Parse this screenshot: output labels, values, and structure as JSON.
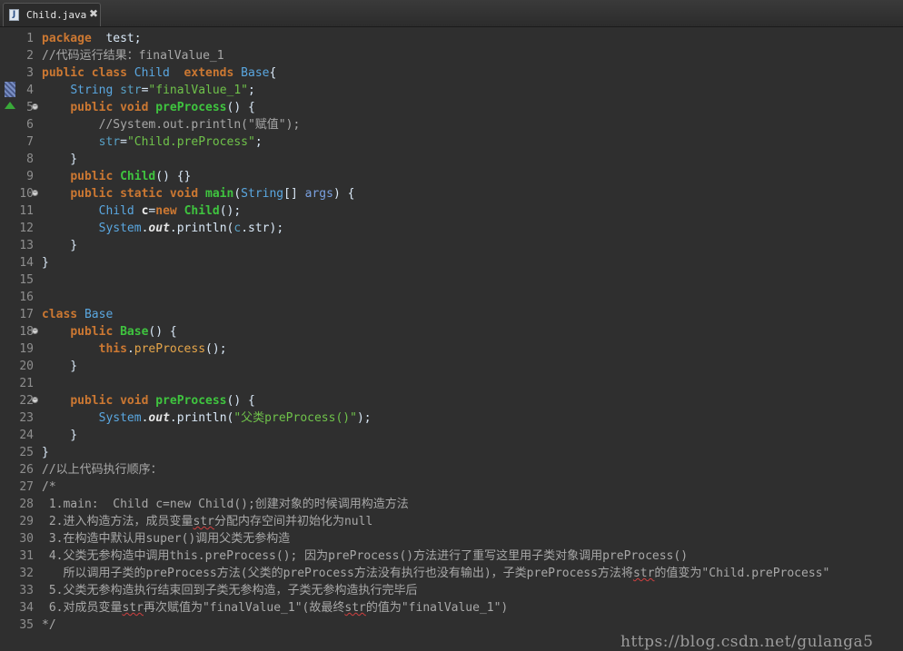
{
  "tab": {
    "title": "Child.java",
    "icon": "java-file-icon",
    "close_glyph": "✖"
  },
  "lines": [
    {
      "n": "1",
      "t": [
        [
          "kw",
          "package"
        ],
        [
          "",
          "  test;"
        ]
      ]
    },
    {
      "n": "2",
      "t": [
        [
          "cmt",
          "//代码运行结果：finalValue_1"
        ]
      ]
    },
    {
      "n": "3",
      "t": [
        [
          "kw",
          "public class "
        ],
        [
          "cls",
          "Child  "
        ],
        [
          "kw",
          "extends "
        ],
        [
          "cls",
          "Base"
        ],
        [
          "",
          "{"
        ]
      ]
    },
    {
      "n": "4",
      "t": [
        [
          "",
          "    "
        ],
        [
          "cls",
          "String "
        ],
        [
          "fld",
          "str"
        ],
        [
          "",
          "="
        ],
        [
          "str",
          "\"finalValue_1\""
        ],
        [
          "",
          ";"
        ]
      ]
    },
    {
      "n": "5",
      "fold": true,
      "t": [
        [
          "",
          "    "
        ],
        [
          "kw",
          "public void "
        ],
        [
          "mth",
          "preProcess"
        ],
        [
          "",
          "() {"
        ]
      ]
    },
    {
      "n": "6",
      "t": [
        [
          "",
          "        "
        ],
        [
          "cmt",
          "//System.out.println(\"赋值\");"
        ]
      ]
    },
    {
      "n": "7",
      "t": [
        [
          "",
          "        "
        ],
        [
          "fld",
          "str"
        ],
        [
          "",
          "="
        ],
        [
          "str",
          "\"Child.preProcess\""
        ],
        [
          "",
          ";"
        ]
      ]
    },
    {
      "n": "8",
      "t": [
        [
          "",
          "    }"
        ]
      ]
    },
    {
      "n": "9",
      "t": [
        [
          "",
          "    "
        ],
        [
          "kw",
          "public "
        ],
        [
          "mth",
          "Child"
        ],
        [
          "",
          "() {}"
        ]
      ]
    },
    {
      "n": "10",
      "fold": true,
      "t": [
        [
          "",
          "    "
        ],
        [
          "kw",
          "public static void "
        ],
        [
          "mth",
          "main"
        ],
        [
          "",
          "("
        ],
        [
          "cls",
          "String"
        ],
        [
          "",
          "[] "
        ],
        [
          "prm",
          "args"
        ],
        [
          "",
          ") {"
        ]
      ]
    },
    {
      "n": "11",
      "t": [
        [
          "",
          "        "
        ],
        [
          "cls",
          "Child "
        ],
        [
          "var",
          "c"
        ],
        [
          "",
          "="
        ],
        [
          "kw",
          "new "
        ],
        [
          "mth",
          "Child"
        ],
        [
          "",
          "();"
        ]
      ]
    },
    {
      "n": "12",
      "t": [
        [
          "",
          "        "
        ],
        [
          "cls",
          "System"
        ],
        [
          "",
          "."
        ],
        [
          "sfld",
          "out"
        ],
        [
          "",
          ".println("
        ],
        [
          "fld",
          "c"
        ],
        [
          "",
          ".str);"
        ]
      ]
    },
    {
      "n": "13",
      "t": [
        [
          "",
          "    }"
        ]
      ]
    },
    {
      "n": "14",
      "t": [
        [
          "",
          "}"
        ]
      ]
    },
    {
      "n": "15",
      "t": []
    },
    {
      "n": "16",
      "t": []
    },
    {
      "n": "17",
      "t": [
        [
          "kw",
          "class "
        ],
        [
          "cls",
          "Base"
        ],
        [
          "",
          "",
          " {"
        ]
      ]
    },
    {
      "n": "18",
      "fold": true,
      "t": [
        [
          "",
          "    "
        ],
        [
          "kw",
          "public "
        ],
        [
          "mth",
          "Base"
        ],
        [
          "",
          "() {"
        ]
      ]
    },
    {
      "n": "19",
      "t": [
        [
          "",
          "        "
        ],
        [
          "kw",
          "this"
        ],
        [
          "",
          "."
        ],
        [
          "call",
          "preProcess"
        ],
        [
          "",
          "();"
        ]
      ]
    },
    {
      "n": "20",
      "t": [
        [
          "",
          "    }"
        ]
      ]
    },
    {
      "n": "21",
      "t": []
    },
    {
      "n": "22",
      "fold": true,
      "t": [
        [
          "",
          "    "
        ],
        [
          "kw",
          "public void "
        ],
        [
          "mth",
          "preProcess"
        ],
        [
          "",
          "() {"
        ]
      ]
    },
    {
      "n": "23",
      "t": [
        [
          "",
          "        "
        ],
        [
          "cls",
          "System"
        ],
        [
          "",
          "."
        ],
        [
          "sfld",
          "out"
        ],
        [
          "",
          ".println("
        ],
        [
          "str",
          "\"父类preProcess()\""
        ],
        [
          "",
          ");"
        ]
      ]
    },
    {
      "n": "24",
      "t": [
        [
          "",
          "    }"
        ]
      ]
    },
    {
      "n": "25",
      "t": [
        [
          "",
          "}"
        ]
      ]
    },
    {
      "n": "26",
      "t": [
        [
          "cmt",
          "//以上代码执行顺序："
        ]
      ]
    },
    {
      "n": "27",
      "t": [
        [
          "cmt",
          "/*"
        ]
      ]
    },
    {
      "n": "28",
      "t": [
        [
          "cmt",
          " 1.main:  Child c=new Child();创建对象的时候调用构造方法"
        ]
      ]
    },
    {
      "n": "29",
      "t": [
        [
          "cmt",
          " 2.进入构造方法，成员变量"
        ],
        [
          "cmt sq",
          "str"
        ],
        [
          "cmt",
          "分配内存空间并初始化为null"
        ]
      ]
    },
    {
      "n": "30",
      "t": [
        [
          "cmt",
          " 3.在构造中默认用super()调用父类无参构造"
        ]
      ]
    },
    {
      "n": "31",
      "t": [
        [
          "cmt",
          " 4.父类无参构造中调用this.preProcess(); 因为preProcess()方法进行了重写这里用子类对象调用preProcess()"
        ]
      ]
    },
    {
      "n": "32",
      "t": [
        [
          "cmt",
          "   所以调用子类的preProcess方法(父类的preProcess方法没有执行也没有输出)，子类preProcess方法将"
        ],
        [
          "cmt sq",
          "str"
        ],
        [
          "cmt",
          "的值变为\"Child.preProcess\""
        ]
      ]
    },
    {
      "n": "33",
      "t": [
        [
          "cmt",
          " 5.父类无参构造执行结束回到子类无参构造，子类无参构造执行完毕后"
        ]
      ]
    },
    {
      "n": "34",
      "t": [
        [
          "cmt",
          " 6.对成员变量"
        ],
        [
          "cmt sq",
          "str"
        ],
        [
          "cmt",
          "再次赋值为\"finalValue_1\"(故最终"
        ],
        [
          "cmt sq",
          "str"
        ],
        [
          "cmt",
          "的值为\"finalValue_1\")"
        ]
      ]
    },
    {
      "n": "35",
      "t": [
        [
          "cmt",
          "*/"
        ]
      ]
    }
  ],
  "watermark": "https://blog.csdn.net/gulanga5"
}
